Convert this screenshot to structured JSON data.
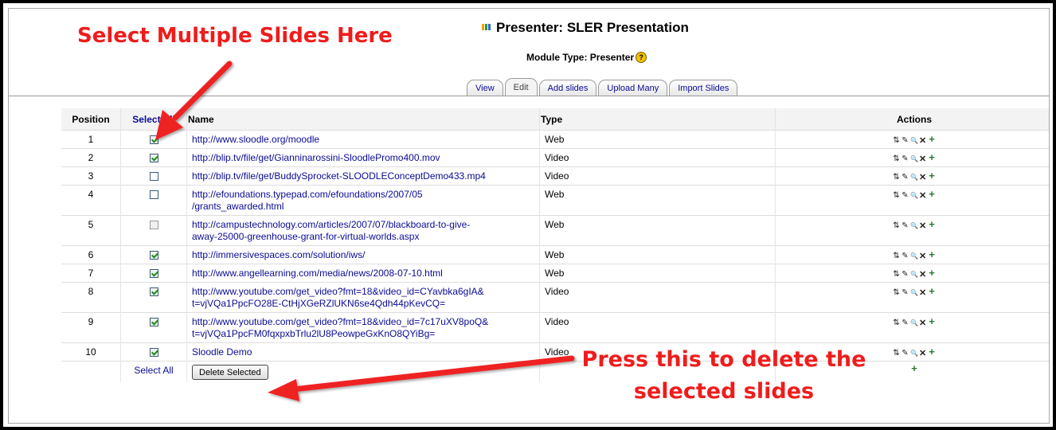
{
  "header": {
    "title": "Presenter: SLER Presentation",
    "module_type": "Module Type: Presenter",
    "help_symbol": "?",
    "tabs": [
      {
        "label": "View",
        "active": false
      },
      {
        "label": "Edit",
        "active": true
      },
      {
        "label": "Add slides",
        "active": false
      },
      {
        "label": "Upload Many",
        "active": false
      },
      {
        "label": "Import Slides",
        "active": false
      }
    ]
  },
  "table": {
    "columns": {
      "position": "Position",
      "select_all": "Select All",
      "name": "Name",
      "type": "Type",
      "actions": "Actions"
    },
    "rows": [
      {
        "position": "1",
        "checked": true,
        "name_line1": "http://www.sloodle.org/moodle",
        "name_line2": "",
        "type": "Web"
      },
      {
        "position": "2",
        "checked": true,
        "name_line1": "http://blip.tv/file/get/Gianninarossini-SloodlePromo400.mov",
        "name_line2": "",
        "type": "Video"
      },
      {
        "position": "3",
        "checked": false,
        "name_line1": "http://blip.tv/file/get/BuddySprocket-SLOODLEConceptDemo433.mp4",
        "name_line2": "",
        "type": "Video"
      },
      {
        "position": "4",
        "checked": false,
        "name_line1": "http://efoundations.typepad.com/efoundations/2007/05",
        "name_line2": "/grants_awarded.html",
        "type": "Web"
      },
      {
        "position": "5",
        "checked": false,
        "disabled": true,
        "name_line1": "http://campustechnology.com/articles/2007/07/blackboard-to-give-",
        "name_line2": "away-25000-greenhouse-grant-for-virtual-worlds.aspx",
        "type": "Web"
      },
      {
        "position": "6",
        "checked": true,
        "name_line1": "http://immersivespaces.com/solution/iws/",
        "name_line2": "",
        "type": "Web"
      },
      {
        "position": "7",
        "checked": true,
        "name_line1": "http://www.angellearning.com/media/news/2008-07-10.html",
        "name_line2": "",
        "type": "Web"
      },
      {
        "position": "8",
        "checked": true,
        "name_line1": "http://www.youtube.com/get_video?fmt=18&video_id=CYavbka6gIA&",
        "name_line2": "t=vjVQa1PpcFO28E-CtHjXGeRZlUKN6se4Qdh44pKevCQ=",
        "type": "Video"
      },
      {
        "position": "9",
        "checked": true,
        "name_line1": "http://www.youtube.com/get_video?fmt=18&video_id=7c17uXV8poQ&",
        "name_line2": "t=vjVQa1PpcFM0fqxpxbTrlu2lU8PeowpeGxKnO8QYiBg=",
        "type": "Video"
      },
      {
        "position": "10",
        "checked": true,
        "name_line1": "Sloodle Demo",
        "name_line2": "",
        "type": "Video"
      }
    ],
    "footer": {
      "select_all": "Select All",
      "delete_button": "Delete Selected"
    }
  },
  "action_icons": {
    "move": "⇅",
    "edit": "✎",
    "view": "🔍",
    "delete": "✕",
    "add": "+"
  },
  "annotations": {
    "top": "Select Multiple Slides Here",
    "bottom_line1": "Press this to delete the",
    "bottom_line2": "selected slides"
  },
  "colors": {
    "annotation": "#ef1c1c",
    "link": "#0b0b94"
  }
}
